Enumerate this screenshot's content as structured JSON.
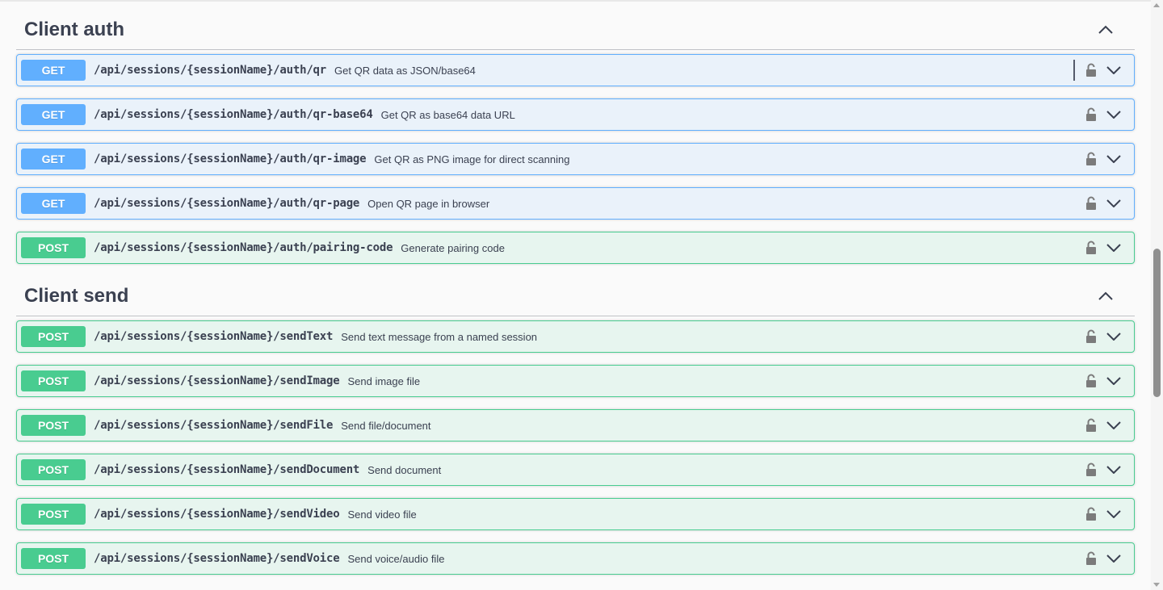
{
  "colors": {
    "get": "#61affe",
    "post": "#49cc90",
    "text": "#3b4151",
    "icon": "#7b7b7b"
  },
  "sections": [
    {
      "title": "Client auth",
      "collapse_icon": "chevron-up-icon",
      "operations": [
        {
          "method": "GET",
          "path": "/api/sessions/{sessionName}/auth/qr",
          "summary": "Get QR data as JSON/base64"
        },
        {
          "method": "GET",
          "path": "/api/sessions/{sessionName}/auth/qr-base64",
          "summary": "Get QR as base64 data URL"
        },
        {
          "method": "GET",
          "path": "/api/sessions/{sessionName}/auth/qr-image",
          "summary": "Get QR as PNG image for direct scanning"
        },
        {
          "method": "GET",
          "path": "/api/sessions/{sessionName}/auth/qr-page",
          "summary": "Open QR page in browser"
        },
        {
          "method": "POST",
          "path": "/api/sessions/{sessionName}/auth/pairing-code",
          "summary": "Generate pairing code"
        }
      ]
    },
    {
      "title": "Client send",
      "collapse_icon": "chevron-up-icon",
      "operations": [
        {
          "method": "POST",
          "path": "/api/sessions/{sessionName}/sendText",
          "summary": "Send text message from a named session"
        },
        {
          "method": "POST",
          "path": "/api/sessions/{sessionName}/sendImage",
          "summary": "Send image file"
        },
        {
          "method": "POST",
          "path": "/api/sessions/{sessionName}/sendFile",
          "summary": "Send file/document"
        },
        {
          "method": "POST",
          "path": "/api/sessions/{sessionName}/sendDocument",
          "summary": "Send document"
        },
        {
          "method": "POST",
          "path": "/api/sessions/{sessionName}/sendVideo",
          "summary": "Send video file"
        },
        {
          "method": "POST",
          "path": "/api/sessions/{sessionName}/sendVoice",
          "summary": "Send voice/audio file"
        }
      ]
    }
  ]
}
